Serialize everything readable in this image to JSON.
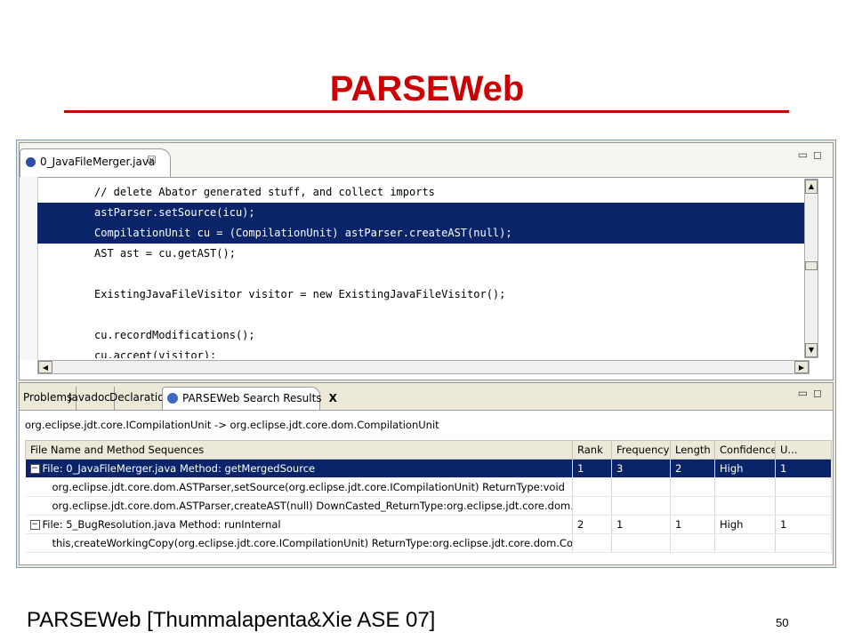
{
  "slide": {
    "title": "PARSEWeb",
    "footer": "PARSEWeb [Thummalapenta&Xie ASE 07]",
    "page_number": "50"
  },
  "editor": {
    "tab_label": "0_JavaFileMerger.java",
    "tab_close": "☒",
    "code_lines": [
      {
        "text": "// delete Abator generated stuff, and collect imports",
        "highlighted": false
      },
      {
        "text": "astParser.setSource(icu);",
        "highlighted": true
      },
      {
        "text": "CompilationUnit cu = (CompilationUnit) astParser.createAST(null);",
        "highlighted": true
      },
      {
        "text": "AST ast = cu.getAST();",
        "highlighted": false
      },
      {
        "text": "",
        "highlighted": false
      },
      {
        "text": "ExistingJavaFileVisitor visitor = new ExistingJavaFileVisitor();",
        "highlighted": false
      },
      {
        "text": "",
        "highlighted": false
      },
      {
        "text": "cu.recordModifications();",
        "highlighted": false
      },
      {
        "text": "cu.accept(visitor);",
        "highlighted": false
      }
    ]
  },
  "view": {
    "tabs": [
      "Problems",
      "Javadoc",
      "Declaration"
    ],
    "active_tab": "PARSEWeb Search Results",
    "active_tab_close": "X",
    "query": "org.eclipse.jdt.core.ICompilationUnit -> org.eclipse.jdt.core.dom.CompilationUnit",
    "columns": [
      "File Name and Method Sequences",
      "Rank",
      "Frequency",
      "Length",
      "Confidence",
      "U..."
    ],
    "rows": [
      {
        "type": "file",
        "selected": true,
        "toggle": "−",
        "cells": [
          "File: 0_JavaFileMerger.java Method: getMergedSource",
          "1",
          "3",
          "2",
          "High",
          "1"
        ]
      },
      {
        "type": "seq",
        "selected": false,
        "cells": [
          "org.eclipse.jdt.core.dom.ASTParser,setSource(org.eclipse.jdt.core.ICompilationUnit) ReturnType:void",
          "",
          "",
          "",
          "",
          ""
        ]
      },
      {
        "type": "seq",
        "selected": false,
        "cells": [
          "org.eclipse.jdt.core.dom.ASTParser,createAST(null) DownCasted_ReturnType:org.eclipse.jdt.core.dom.CompilationUnit",
          "",
          "",
          "",
          "",
          ""
        ]
      },
      {
        "type": "file",
        "selected": false,
        "toggle": "−",
        "cells": [
          "File: 5_BugResolution.java Method: runInternal",
          "2",
          "1",
          "1",
          "High",
          "1"
        ]
      },
      {
        "type": "seq",
        "selected": false,
        "cells": [
          "this,createWorkingCopy(org.eclipse.jdt.core.ICompilationUnit) ReturnType:org.eclipse.jdt.core.dom.CompilationUnit",
          "",
          "",
          "",
          "",
          ""
        ]
      }
    ]
  },
  "colors": {
    "title": "#cc0000",
    "selection": "#0a246a",
    "chrome": "#ece9d8"
  }
}
